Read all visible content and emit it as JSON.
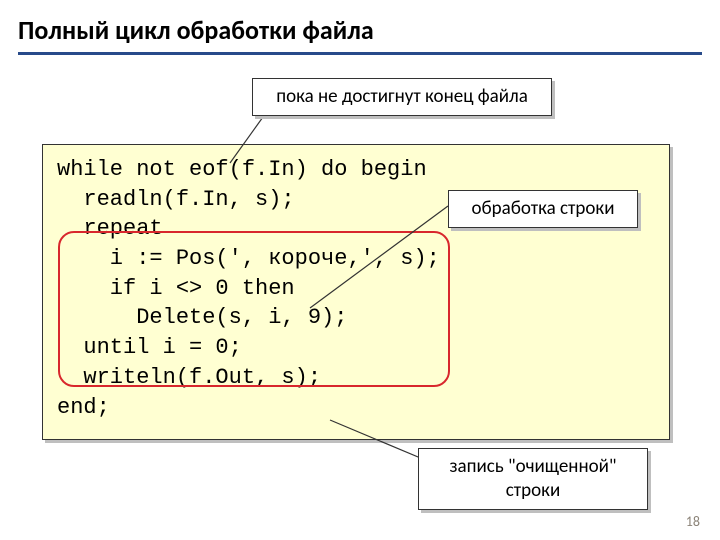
{
  "title": "Полный цикл обработки файла",
  "callouts": {
    "top": "пока не достигнут конец файла",
    "right": "обработка строки",
    "bottom": "запись \"очищенной\" строки"
  },
  "code": {
    "l1": "while not eof(f.In) do begin",
    "l2": "  readln(f.In, s);",
    "l3": "  repeat",
    "l4": "    i := Pos(', короче,', s);",
    "l5": "    if i <> 0 then",
    "l6": "      Delete(s, i, 9);",
    "l7": "  until i = 0;",
    "l8": "  writeln(f.Out, s);",
    "l9": "end;"
  },
  "page_number": "18"
}
